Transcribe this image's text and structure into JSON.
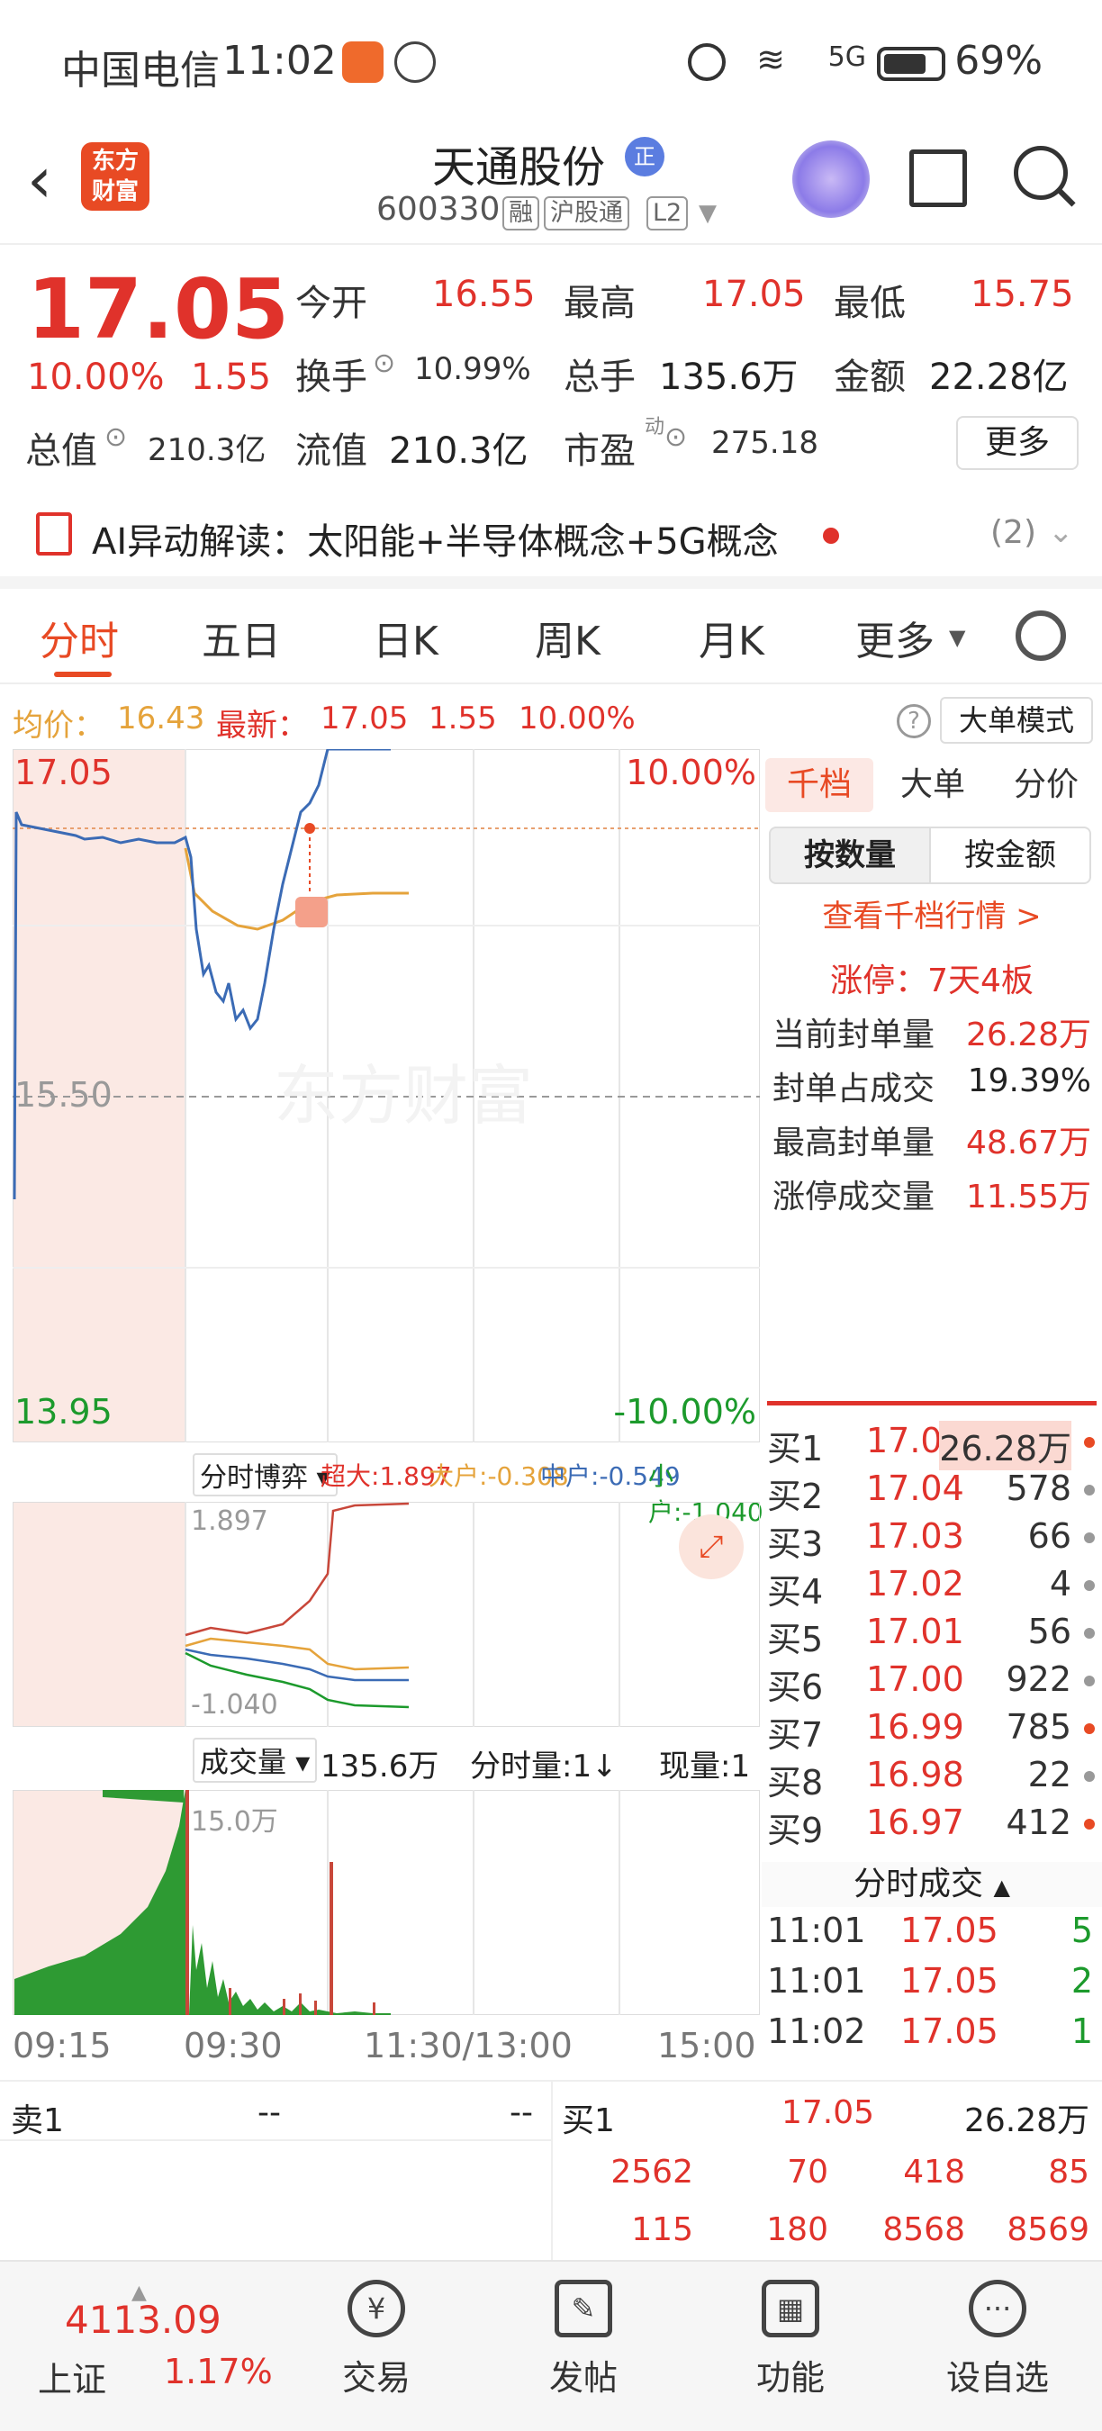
{
  "status_bar": {
    "carrier": "中国电信",
    "time": "11:02",
    "network": "5G",
    "battery": "69%"
  },
  "header": {
    "back_icon": "chevron-left-icon",
    "logo_text": "东方财富",
    "stock_name": "天通股份",
    "badge": "正",
    "code": "600330",
    "tags": [
      "融",
      "沪股通",
      "L2"
    ]
  },
  "quote": {
    "price": "17.05",
    "change_pct": "10.00%",
    "change_abs": "1.55",
    "open_label": "今开",
    "open": "16.55",
    "high_label": "最高",
    "high": "17.05",
    "low_label": "最低",
    "low": "15.75",
    "turnover_label": "换手",
    "turnover": "10.99%",
    "volume_label": "总手",
    "volume": "135.6万",
    "amount_label": "金额",
    "amount": "22.28亿",
    "mktcap_label": "总值",
    "mktcap": "210.3亿",
    "float_label": "流值",
    "float": "210.3亿",
    "pe_label": "市盈",
    "pe_sup": "动",
    "pe": "275.18",
    "more": "更多"
  },
  "ai": {
    "text": "AI异动解读：太阳能+半导体概念+5G概念",
    "count": "(2)"
  },
  "tabs": [
    "分时",
    "五日",
    "日K",
    "周K",
    "月K",
    "更多"
  ],
  "info_line": {
    "avg_label": "均价：",
    "avg": "16.43",
    "latest_label": "最新：",
    "latest": "17.05",
    "chg": "1.55",
    "pct": "10.00%",
    "mode_btn": "大单模式"
  },
  "chart": {
    "top_price": "17.05",
    "top_pct": "10.00%",
    "mid_price": "15.50",
    "bottom_price": "13.95",
    "bottom_pct": "-10.00%",
    "watermark": "东方财富",
    "marker": "B",
    "times": [
      "09:15",
      "09:30",
      "11:30/13:00",
      "15:00"
    ]
  },
  "flow": {
    "selector": "分时博弈",
    "super_label": "超大:",
    "super": "1.897",
    "large_label": "大户:",
    "large": "-0.308",
    "mid_label": "中户:",
    "mid": "-0.549",
    "small_label": "小户:",
    "small": "-1.040",
    "axis_top": "1.897",
    "axis_bottom": "-1.040"
  },
  "volume": {
    "selector": "成交量",
    "total": "135.6万",
    "tick_label": "分时量:1↓",
    "current_label": "现量:1",
    "axis_top": "15.0万"
  },
  "right_panel": {
    "tabs": [
      "千档",
      "大单",
      "分价"
    ],
    "seg": [
      "按数量",
      "按金额"
    ],
    "link": "查看千档行情 >",
    "limit": "涨停：7天4板",
    "stats": [
      {
        "label": "当前封单量",
        "value": "26.28万"
      },
      {
        "label": "封单占成交",
        "value": "19.39%"
      },
      {
        "label": "最高封单量",
        "value": "48.67万"
      },
      {
        "label": "涨停成交量",
        "value": "11.55万"
      }
    ],
    "bids": [
      {
        "label": "买1",
        "price": "17.05",
        "vol": "26.28万",
        "dot": "#e84a24"
      },
      {
        "label": "买2",
        "price": "17.04",
        "vol": "578",
        "dot": "#999999"
      },
      {
        "label": "买3",
        "price": "17.03",
        "vol": "66",
        "dot": "#999999"
      },
      {
        "label": "买4",
        "price": "17.02",
        "vol": "4",
        "dot": "#999999"
      },
      {
        "label": "买5",
        "price": "17.01",
        "vol": "56",
        "dot": "#999999"
      },
      {
        "label": "买6",
        "price": "17.00",
        "vol": "922",
        "dot": "#999999"
      },
      {
        "label": "买7",
        "price": "16.99",
        "vol": "785",
        "dot": "#e84a24"
      },
      {
        "label": "买8",
        "price": "16.98",
        "vol": "22",
        "dot": "#999999"
      },
      {
        "label": "买9",
        "price": "16.97",
        "vol": "412",
        "dot": "#e84a24"
      }
    ],
    "trades_title": "分时成交",
    "trades": [
      {
        "time": "11:01",
        "price": "17.05",
        "vol": "5"
      },
      {
        "time": "11:01",
        "price": "17.05",
        "vol": "2"
      },
      {
        "time": "11:02",
        "price": "17.05",
        "vol": "1"
      }
    ]
  },
  "orders": {
    "sell_label": "卖1",
    "sell_price": "--",
    "sell_vol": "--",
    "buy_label": "买1",
    "buy_price": "17.05",
    "buy_vol": "26.28万",
    "queue_row1": [
      "2562",
      "70",
      "418",
      "85"
    ],
    "queue_row2": [
      "115",
      "180",
      "8568",
      "8569"
    ]
  },
  "nav": {
    "index_value": "4113.09",
    "index_name": "上证",
    "index_pct": "1.17%",
    "items": [
      "交易",
      "发帖",
      "功能",
      "设自选"
    ]
  },
  "colors": {
    "up": "#e0322b",
    "down": "#1c9a2c",
    "accent": "#e84a24",
    "price_line": "#3b6bb5",
    "avg_line": "#e5a33b"
  }
}
